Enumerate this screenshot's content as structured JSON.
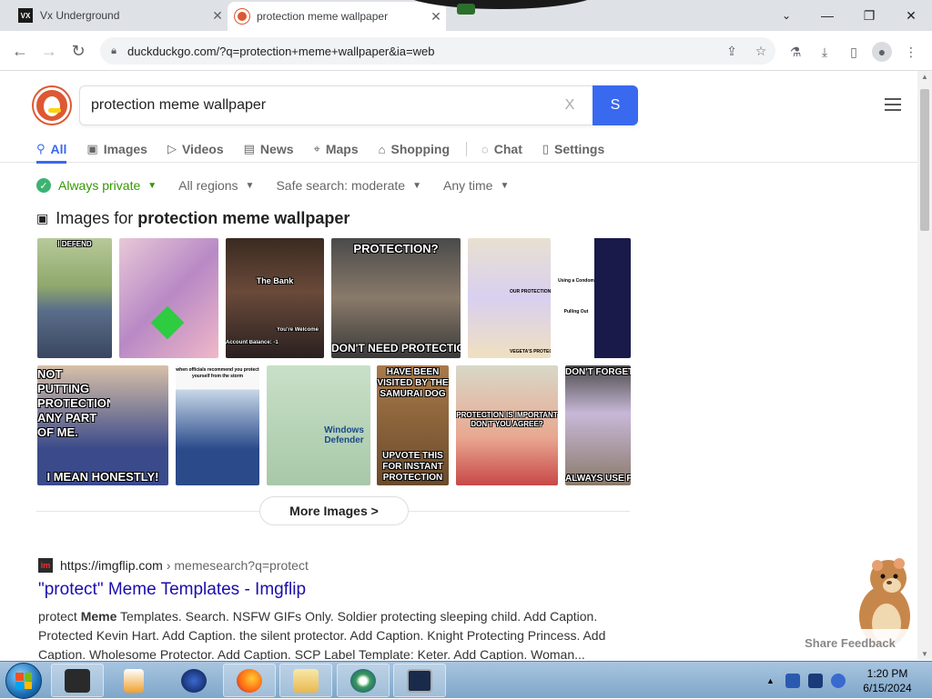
{
  "browser": {
    "tabs": [
      {
        "favicon": "VX",
        "title": "Vx Underground",
        "close": "✕"
      },
      {
        "title": "protection meme wallpaper",
        "close": "✕"
      }
    ],
    "url": "duckduckgo.com/?q=protection+meme+wallpaper&ia=web"
  },
  "search": {
    "query": "protection meme wallpaper",
    "clear": "X",
    "button": "S"
  },
  "nav": {
    "tabs": [
      {
        "label": "All",
        "icon": "search-icon"
      },
      {
        "label": "Images",
        "icon": "image-icon"
      },
      {
        "label": "Videos",
        "icon": "play-icon"
      },
      {
        "label": "News",
        "icon": "news-icon"
      },
      {
        "label": "Maps",
        "icon": "map-pin-icon"
      },
      {
        "label": "Shopping",
        "icon": "bag-icon"
      },
      {
        "label": "Chat",
        "icon": "chat-icon"
      },
      {
        "label": "Settings",
        "icon": "settings-icon"
      }
    ]
  },
  "filters": {
    "private": "Always private",
    "regions": "All regions",
    "safe_search": "Safe search: moderate",
    "time": "Any time"
  },
  "images": {
    "heading_prefix": "Images for",
    "heading_query": "protection meme wallpaper",
    "captions": {
      "t1": "I DEFEND",
      "t3_a": "The Bank",
      "t3_b": "You're Welcome",
      "t3_c": "Account Balance: -18,758",
      "t4_a": "PROTECTION?",
      "t4_b": "DON'T NEED PROTECTION",
      "t5_a": "OUR PROTECTION",
      "t5_b": "VEGETA'S PROTECTION",
      "t6_a": "Using a Condom",
      "t6_b": "Pulling Out",
      "t7_a": "NOT PUTTING PROTECTION ANY PART OF ME.",
      "t7_b": "I MEAN HONESTLY!",
      "t8": "when officials recommend you protect yourself from the storm",
      "t9": "Windows Defender",
      "t10_a": "HAVE BEEN VISITED BY THE SAMURAI DOG",
      "t10_b": "UPVOTE THIS FOR INSTANT PROTECTION",
      "t11": "PROTECTION IS IMPORTANT DON'T YOU AGREE?",
      "t12_a": "DON'T FORGET, KIDS",
      "t12_b": "ALWAYS USE PROTECTION"
    },
    "more_label": "More Images >"
  },
  "result": {
    "favicon": "im",
    "domain": "https://imgflip.com",
    "path": "› memesearch?q=protect",
    "title": "\"protect\" Meme Templates - Imgflip",
    "snippet_pre": "protect ",
    "snippet_bold": "Meme",
    "snippet_post": " Templates. Search. NSFW GIFs Only. Soldier protecting sleeping child. Add Caption. Protected Kevin Hart. Add Caption. the silent protector. Add Caption. Knight Protecting Princess. Add Caption. Wholesome Protector. Add Caption. SCP Label Template: Keter. Add Caption. Woman..."
  },
  "feedback": "Share Feedback",
  "taskbar": {
    "time": "1:20 PM",
    "date": "6/15/2024"
  },
  "colors": {
    "accent": "#3969ef",
    "ddg_orange": "#de5833",
    "link": "#1a0dab",
    "private_green": "#339900"
  }
}
